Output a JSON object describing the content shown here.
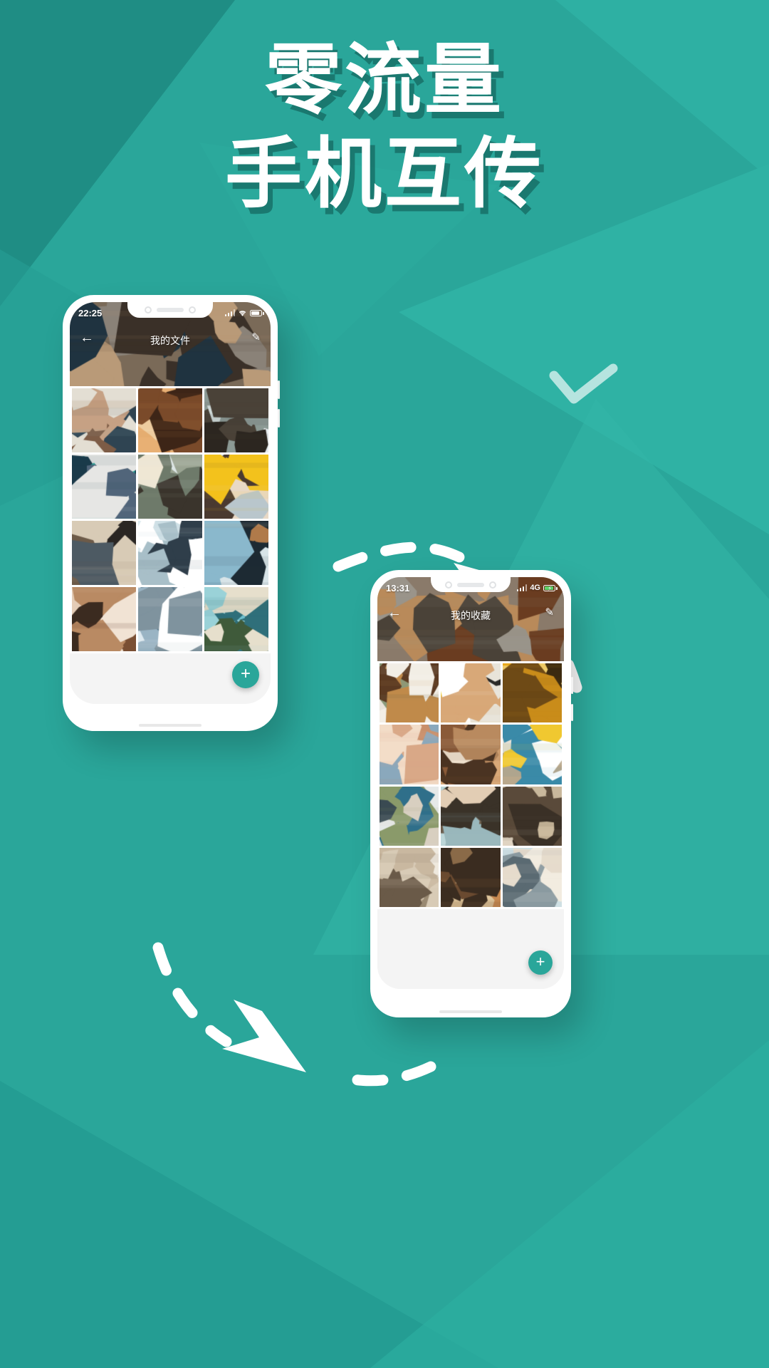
{
  "theme": {
    "background": "#2aa69a",
    "background_dark": "#1f8d84",
    "background_light": "#33b6a8",
    "accent": "#2aa69a",
    "text_on_bg": "#ffffff",
    "shadow": "#0c524c"
  },
  "headline": {
    "line1": "零流量",
    "line2": "手机互传"
  },
  "phones": [
    {
      "id": "phone-left",
      "status": {
        "time": "22:25",
        "signal_icon": "signal-bars-icon",
        "wifi_icon": "wifi-icon",
        "battery_icon": "battery-icon",
        "battery_charging": false,
        "network_label": ""
      },
      "header": {
        "back_icon": "back-arrow-icon",
        "title": "我的文件",
        "edit_icon": "pencil-edit-icon"
      },
      "fab": {
        "icon": "plus-icon",
        "label": "+"
      },
      "gallery": {
        "rows": 4,
        "columns": 3,
        "thumbnails": [
          "couple-in-sweaters-winter",
          "people-around-bonfire",
          "person-walking-snowy-forest",
          "skateboard-on-pavement",
          "hiker-in-snowy-pines",
          "woman-in-yellow-jacket",
          "dancer-under-bridge",
          "two-skiers-arms-raised",
          "snowboarder-on-slope",
          "two-women-lying-down",
          "snowy-mountain-peak",
          "tropical-beach-island"
        ]
      }
    },
    {
      "id": "phone-right",
      "status": {
        "time": "13:31",
        "signal_icon": "signal-bars-icon",
        "network_label": "4G",
        "battery_icon": "battery-charging-icon",
        "battery_charging": true
      },
      "header": {
        "back_icon": "back-arrow-icon",
        "title": "我的收藏",
        "edit_icon": "pencil-edit-icon"
      },
      "fab": {
        "icon": "plus-icon",
        "label": "+"
      },
      "gallery": {
        "rows": 4,
        "columns": 3,
        "thumbnails": [
          "pastry-and-berries-flatlay",
          "woman-with-please-sign",
          "sunflower-close-up",
          "clouds-peach-sky",
          "woman-in-tan-coat",
          "hand-holding-yellow-flag",
          "floral-sweater-detail",
          "portrait-with-fur-collar",
          "dried-flowers-arrangement",
          "hands-in-knit-sleeves",
          "desert-highway-road",
          "arch-doorway-blue-sky"
        ]
      }
    }
  ],
  "decorations": {
    "arrow_up_right": "dashed-arrow-up-right",
    "arrow_down_left": "dashed-arrow-down-left",
    "check_mark": "check-mark-decoration"
  }
}
